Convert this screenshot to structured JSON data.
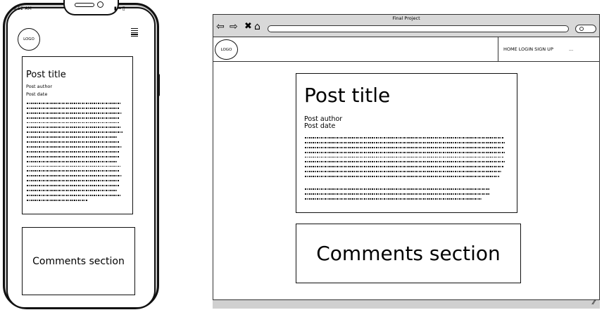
{
  "mobile": {
    "status_time": "9:52 AM",
    "logo_text": "LOGO",
    "post": {
      "title": "Post title",
      "author": "Post author",
      "date": "Post date",
      "paragraph_lines": [
        0.92,
        0.9,
        0.93,
        0.91,
        0.9,
        0.92,
        0.94,
        0.88,
        0.9,
        0.93,
        0.91,
        0.9,
        0.89,
        0.92,
        0.9,
        0.93,
        0.91,
        0.9,
        0.89,
        0.92,
        0.6
      ]
    },
    "comments_label": "Comments section",
    "icons": [
      "signal-icon",
      "wifi-icon",
      "battery-icon",
      "hamburger-menu-icon"
    ]
  },
  "desktop": {
    "window_title": "Final Project",
    "logo_text": "LOGO",
    "nav_text": "HOME LOGIN SIGN UP",
    "nav_more": "...",
    "post": {
      "title": "Post title",
      "author": "Post author",
      "date": "Post date",
      "paragraph1_lines": [
        0.98,
        0.99,
        0.98,
        0.99,
        0.98,
        0.99,
        0.98,
        0.97,
        0.96
      ],
      "paragraph2_lines": [
        0.97,
        0.97,
        0.93
      ]
    },
    "comments_label": "Comments section",
    "icons": [
      "back-arrow-icon",
      "forward-arrow-icon",
      "close-icon",
      "home-icon",
      "search-icon",
      "resize-grip-icon"
    ]
  }
}
